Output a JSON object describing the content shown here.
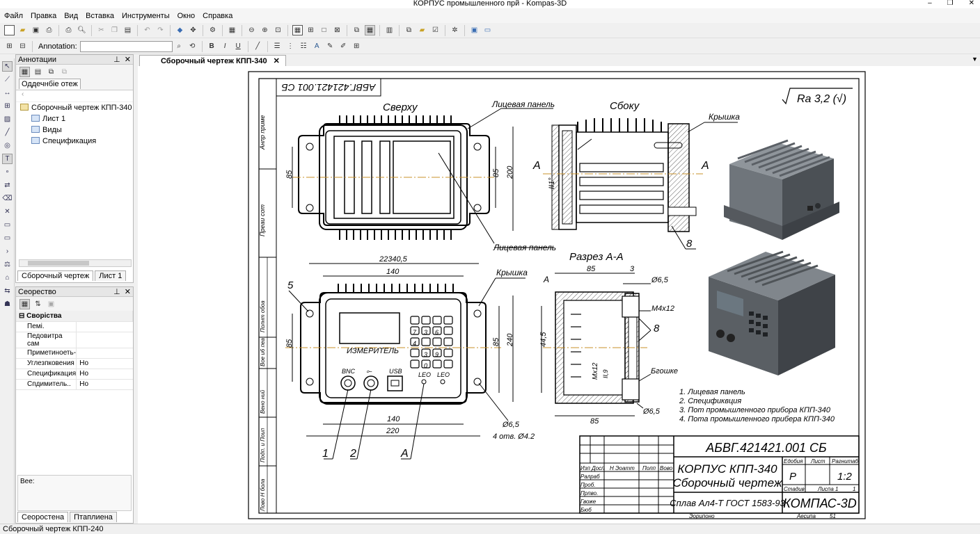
{
  "window": {
    "title": "КОРПУС промышленного прй - Kompas-3D",
    "controls": [
      "–",
      "❐",
      "✕"
    ]
  },
  "menu": [
    "Файл",
    "Правка",
    "Вид",
    "Вставка",
    "Инструменты",
    "Окно",
    "Справка"
  ],
  "toolbar2": {
    "annotation_label": "Annotation:",
    "annotation_value": ""
  },
  "annot_panel": {
    "title": "Аннотации",
    "tab": "Оддечнбіе отеж",
    "tree": [
      "Сборочный чертеж КПП-340",
      "Лист 1",
      "Виды",
      "Спецификация"
    ],
    "bottom_tabs": [
      "Сборочный чертеж",
      "Лист 1"
    ]
  },
  "props_panel": {
    "title": "Сеорество",
    "section": "Своріства",
    "rows": [
      {
        "name": "Пемі.",
        "value": ""
      },
      {
        "name": "Педовитра сам",
        "value": ""
      },
      {
        "name": "Приметиноеть-",
        "value": ""
      },
      {
        "name": "Углезпковения",
        "value": "Но"
      },
      {
        "name": "Спецификация",
        "value": "Но"
      },
      {
        "name": "Спдимитель..",
        "value": "Но"
      }
    ],
    "desc_label": "Вее:",
    "bottom_tabs": [
      "Сеоростена",
      "Птаплиена"
    ]
  },
  "document": {
    "tab_title": "Сборочный чертеж КПП-340",
    "mirrored_stamp": "АБВГ.421421.001 СБ",
    "roughness": "Ra 3,2 (√)",
    "view_labels": {
      "top": "Сверху",
      "side": "Сбоку",
      "section": "Разрез А-А"
    },
    "callouts": [
      "Лицевая панель",
      "Крышка",
      "Лицевая панель",
      "Крышка",
      "Бгошке",
      "8",
      "8",
      "A",
      "A",
      "5",
      "1",
      "2",
      "A"
    ],
    "dims": [
      "85",
      "200",
      "II1°",
      "22340,5",
      "140",
      "85",
      "240",
      "140",
      "220",
      "Ø6,5",
      "4 отв. Ø4.2",
      "85",
      "3",
      "Ø6,5",
      "М4х12",
      "44,5",
      "Мх12",
      "II,9",
      "Ø6,5",
      "85"
    ],
    "front_text": {
      "device": "ИЗМЕРИТЕЛЬ",
      "bnc": "BNC",
      "usb": "USB",
      "led1": "LEO",
      "led2": "LEO"
    },
    "keypad": [
      "",
      "",
      "",
      "",
      "",
      "",
      "",
      "",
      "7",
      "3",
      "6",
      "",
      "4",
      "3",
      "9",
      "",
      "",
      "0",
      "",
      ""
    ],
    "notes": [
      "1. Лицевая панель",
      "2. Спецификвция",
      "3. Пот промышленного прибора КПП-340",
      "4. Пота промышленного прибера КПП-340"
    ],
    "title_block": {
      "code": "АБВГ.421421.001 СБ",
      "name_line1": "КОРПУС КПП-340",
      "name_line2": "Сборочный чертеж",
      "material": "Сплав Ал4-Т ГОСТ 1583-93",
      "company": "КОМПАС-3D",
      "stage_header": "Едобия",
      "sheet_header": "Лист",
      "scale_header": "Рагнитаб",
      "stage_value": "Р",
      "scale_value": "1:2",
      "stadia": "Стадив",
      "sheet_count": "Лиспа 1",
      "sheet_count2": "1",
      "row_labels": [
        "Изп Досп",
        "Ралраб",
        "Проб.",
        "Прпво.",
        "Гвоже",
        "Бюб"
      ],
      "col_labels": [
        "Н Эоатт",
        "Попп",
        "Вово"
      ],
      "footer_left": "Эорипоно",
      "footer_right": "Аесипа",
      "footer_num": "51"
    },
    "side_strip": [
      "Анпр приме",
      "Преаи сот",
      "Полнт обоа",
      "Вое и6 пеа",
      "Вено ний",
      "Подп. и Поип",
      "Лово Н бола"
    ]
  },
  "status": {
    "text": "Сборочный чертеж КПП-240"
  }
}
